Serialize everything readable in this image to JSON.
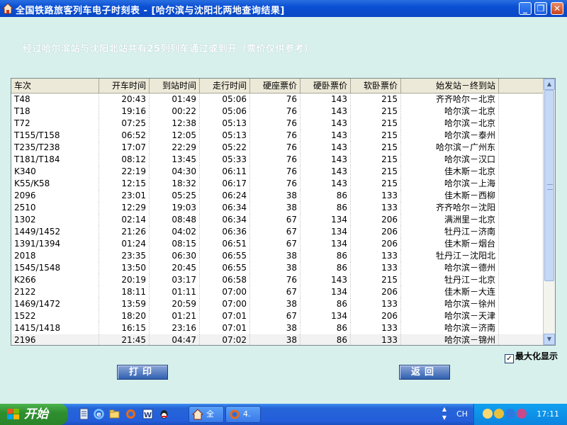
{
  "window": {
    "title": "全国铁路旅客列车电子时刻表 - [哈尔滨与沈阳北两地查询结果]",
    "minimize_label": "_",
    "restore_label": "❐",
    "close_label": "✕"
  },
  "summary": "经过哈尔滨站与沈阳北站共有25列列车通过或到开（票价仅供参考）",
  "table": {
    "columns": [
      "车次",
      "开车时间",
      "到站时间",
      "走行时间",
      "硬座票价",
      "硬卧票价",
      "软卧票价",
      "始发站－终到站"
    ],
    "rows": [
      [
        "T48",
        "20:43",
        "01:49",
        "05:06",
        "76",
        "143",
        "215",
        "齐齐哈尔－北京"
      ],
      [
        "T18",
        "19:16",
        "00:22",
        "05:06",
        "76",
        "143",
        "215",
        "哈尔滨－北京"
      ],
      [
        "T72",
        "07:25",
        "12:38",
        "05:13",
        "76",
        "143",
        "215",
        "哈尔滨－北京"
      ],
      [
        "T155/T158",
        "06:52",
        "12:05",
        "05:13",
        "76",
        "143",
        "215",
        "哈尔滨－泰州"
      ],
      [
        "T235/T238",
        "17:07",
        "22:29",
        "05:22",
        "76",
        "143",
        "215",
        "哈尔滨－广州东"
      ],
      [
        "T181/T184",
        "08:12",
        "13:45",
        "05:33",
        "76",
        "143",
        "215",
        "哈尔滨－汉口"
      ],
      [
        "K340",
        "22:19",
        "04:30",
        "06:11",
        "76",
        "143",
        "215",
        "佳木斯－北京"
      ],
      [
        "K55/K58",
        "12:15",
        "18:32",
        "06:17",
        "76",
        "143",
        "215",
        "哈尔滨－上海"
      ],
      [
        "2096",
        "23:01",
        "05:25",
        "06:24",
        "38",
        "86",
        "133",
        "佳木斯－西柳"
      ],
      [
        "2510",
        "12:29",
        "19:03",
        "06:34",
        "38",
        "86",
        "133",
        "齐齐哈尔－沈阳"
      ],
      [
        "1302",
        "02:14",
        "08:48",
        "06:34",
        "67",
        "134",
        "206",
        "满洲里－北京"
      ],
      [
        "1449/1452",
        "21:26",
        "04:02",
        "06:36",
        "67",
        "134",
        "206",
        "牡丹江－济南"
      ],
      [
        "1391/1394",
        "01:24",
        "08:15",
        "06:51",
        "67",
        "134",
        "206",
        "佳木斯－烟台"
      ],
      [
        "2018",
        "23:35",
        "06:30",
        "06:55",
        "38",
        "86",
        "133",
        "牡丹江－沈阳北"
      ],
      [
        "1545/1548",
        "13:50",
        "20:45",
        "06:55",
        "38",
        "86",
        "133",
        "哈尔滨－德州"
      ],
      [
        "K266",
        "20:19",
        "03:17",
        "06:58",
        "76",
        "143",
        "215",
        "牡丹江－北京"
      ],
      [
        "2122",
        "18:11",
        "01:11",
        "07:00",
        "67",
        "134",
        "206",
        "佳木斯－大连"
      ],
      [
        "1469/1472",
        "13:59",
        "20:59",
        "07:00",
        "38",
        "86",
        "133",
        "哈尔滨－徐州"
      ],
      [
        "1522",
        "18:20",
        "01:21",
        "07:01",
        "67",
        "134",
        "206",
        "哈尔滨－天津"
      ],
      [
        "1415/1418",
        "16:15",
        "23:16",
        "07:01",
        "38",
        "86",
        "133",
        "哈尔滨－济南"
      ],
      [
        "2196",
        "21:45",
        "04:47",
        "07:02",
        "38",
        "86",
        "133",
        "哈尔滨－锦州"
      ]
    ]
  },
  "maximize_checkbox": {
    "label": "最大化显示",
    "checked": true,
    "check_mark": "✓"
  },
  "buttons": {
    "print": "打印",
    "back": "返回"
  },
  "taskbar": {
    "start_label": "开始",
    "tasks": [
      {
        "label": "全"
      },
      {
        "label": "4."
      }
    ],
    "ime": "CH",
    "clock": "17:11"
  },
  "colors": {
    "background": "#d8f0ec",
    "titlebar": "#0a4fd4",
    "taskbar": "#245edb",
    "start": "#2f8f2f",
    "button": "#3060b0"
  },
  "icons": [
    "home-icon",
    "windows-flag-icon",
    "ie-icon",
    "folder-icon",
    "word-icon",
    "qq-icon",
    "firefox-icon"
  ]
}
